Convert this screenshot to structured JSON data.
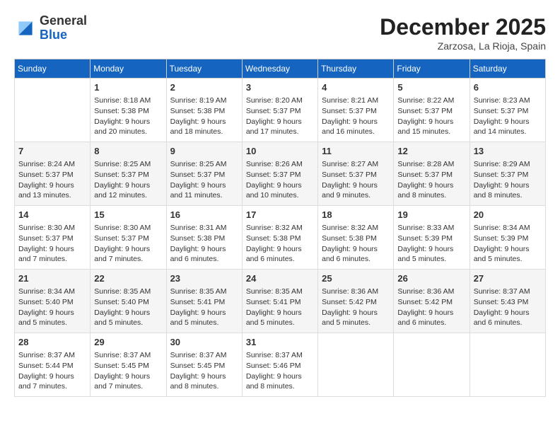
{
  "logo": {
    "general": "General",
    "blue": "Blue"
  },
  "title": "December 2025",
  "location": "Zarzosa, La Rioja, Spain",
  "days_of_week": [
    "Sunday",
    "Monday",
    "Tuesday",
    "Wednesday",
    "Thursday",
    "Friday",
    "Saturday"
  ],
  "weeks": [
    [
      {
        "num": "",
        "info": ""
      },
      {
        "num": "1",
        "info": "Sunrise: 8:18 AM\nSunset: 5:38 PM\nDaylight: 9 hours\nand 20 minutes."
      },
      {
        "num": "2",
        "info": "Sunrise: 8:19 AM\nSunset: 5:38 PM\nDaylight: 9 hours\nand 18 minutes."
      },
      {
        "num": "3",
        "info": "Sunrise: 8:20 AM\nSunset: 5:37 PM\nDaylight: 9 hours\nand 17 minutes."
      },
      {
        "num": "4",
        "info": "Sunrise: 8:21 AM\nSunset: 5:37 PM\nDaylight: 9 hours\nand 16 minutes."
      },
      {
        "num": "5",
        "info": "Sunrise: 8:22 AM\nSunset: 5:37 PM\nDaylight: 9 hours\nand 15 minutes."
      },
      {
        "num": "6",
        "info": "Sunrise: 8:23 AM\nSunset: 5:37 PM\nDaylight: 9 hours\nand 14 minutes."
      }
    ],
    [
      {
        "num": "7",
        "info": "Sunrise: 8:24 AM\nSunset: 5:37 PM\nDaylight: 9 hours\nand 13 minutes."
      },
      {
        "num": "8",
        "info": "Sunrise: 8:25 AM\nSunset: 5:37 PM\nDaylight: 9 hours\nand 12 minutes."
      },
      {
        "num": "9",
        "info": "Sunrise: 8:25 AM\nSunset: 5:37 PM\nDaylight: 9 hours\nand 11 minutes."
      },
      {
        "num": "10",
        "info": "Sunrise: 8:26 AM\nSunset: 5:37 PM\nDaylight: 9 hours\nand 10 minutes."
      },
      {
        "num": "11",
        "info": "Sunrise: 8:27 AM\nSunset: 5:37 PM\nDaylight: 9 hours\nand 9 minutes."
      },
      {
        "num": "12",
        "info": "Sunrise: 8:28 AM\nSunset: 5:37 PM\nDaylight: 9 hours\nand 8 minutes."
      },
      {
        "num": "13",
        "info": "Sunrise: 8:29 AM\nSunset: 5:37 PM\nDaylight: 9 hours\nand 8 minutes."
      }
    ],
    [
      {
        "num": "14",
        "info": "Sunrise: 8:30 AM\nSunset: 5:37 PM\nDaylight: 9 hours\nand 7 minutes."
      },
      {
        "num": "15",
        "info": "Sunrise: 8:30 AM\nSunset: 5:37 PM\nDaylight: 9 hours\nand 7 minutes."
      },
      {
        "num": "16",
        "info": "Sunrise: 8:31 AM\nSunset: 5:38 PM\nDaylight: 9 hours\nand 6 minutes."
      },
      {
        "num": "17",
        "info": "Sunrise: 8:32 AM\nSunset: 5:38 PM\nDaylight: 9 hours\nand 6 minutes."
      },
      {
        "num": "18",
        "info": "Sunrise: 8:32 AM\nSunset: 5:38 PM\nDaylight: 9 hours\nand 6 minutes."
      },
      {
        "num": "19",
        "info": "Sunrise: 8:33 AM\nSunset: 5:39 PM\nDaylight: 9 hours\nand 5 minutes."
      },
      {
        "num": "20",
        "info": "Sunrise: 8:34 AM\nSunset: 5:39 PM\nDaylight: 9 hours\nand 5 minutes."
      }
    ],
    [
      {
        "num": "21",
        "info": "Sunrise: 8:34 AM\nSunset: 5:40 PM\nDaylight: 9 hours\nand 5 minutes."
      },
      {
        "num": "22",
        "info": "Sunrise: 8:35 AM\nSunset: 5:40 PM\nDaylight: 9 hours\nand 5 minutes."
      },
      {
        "num": "23",
        "info": "Sunrise: 8:35 AM\nSunset: 5:41 PM\nDaylight: 9 hours\nand 5 minutes."
      },
      {
        "num": "24",
        "info": "Sunrise: 8:35 AM\nSunset: 5:41 PM\nDaylight: 9 hours\nand 5 minutes."
      },
      {
        "num": "25",
        "info": "Sunrise: 8:36 AM\nSunset: 5:42 PM\nDaylight: 9 hours\nand 5 minutes."
      },
      {
        "num": "26",
        "info": "Sunrise: 8:36 AM\nSunset: 5:42 PM\nDaylight: 9 hours\nand 6 minutes."
      },
      {
        "num": "27",
        "info": "Sunrise: 8:37 AM\nSunset: 5:43 PM\nDaylight: 9 hours\nand 6 minutes."
      }
    ],
    [
      {
        "num": "28",
        "info": "Sunrise: 8:37 AM\nSunset: 5:44 PM\nDaylight: 9 hours\nand 7 minutes."
      },
      {
        "num": "29",
        "info": "Sunrise: 8:37 AM\nSunset: 5:45 PM\nDaylight: 9 hours\nand 7 minutes."
      },
      {
        "num": "30",
        "info": "Sunrise: 8:37 AM\nSunset: 5:45 PM\nDaylight: 9 hours\nand 8 minutes."
      },
      {
        "num": "31",
        "info": "Sunrise: 8:37 AM\nSunset: 5:46 PM\nDaylight: 9 hours\nand 8 minutes."
      },
      {
        "num": "",
        "info": ""
      },
      {
        "num": "",
        "info": ""
      },
      {
        "num": "",
        "info": ""
      }
    ]
  ]
}
